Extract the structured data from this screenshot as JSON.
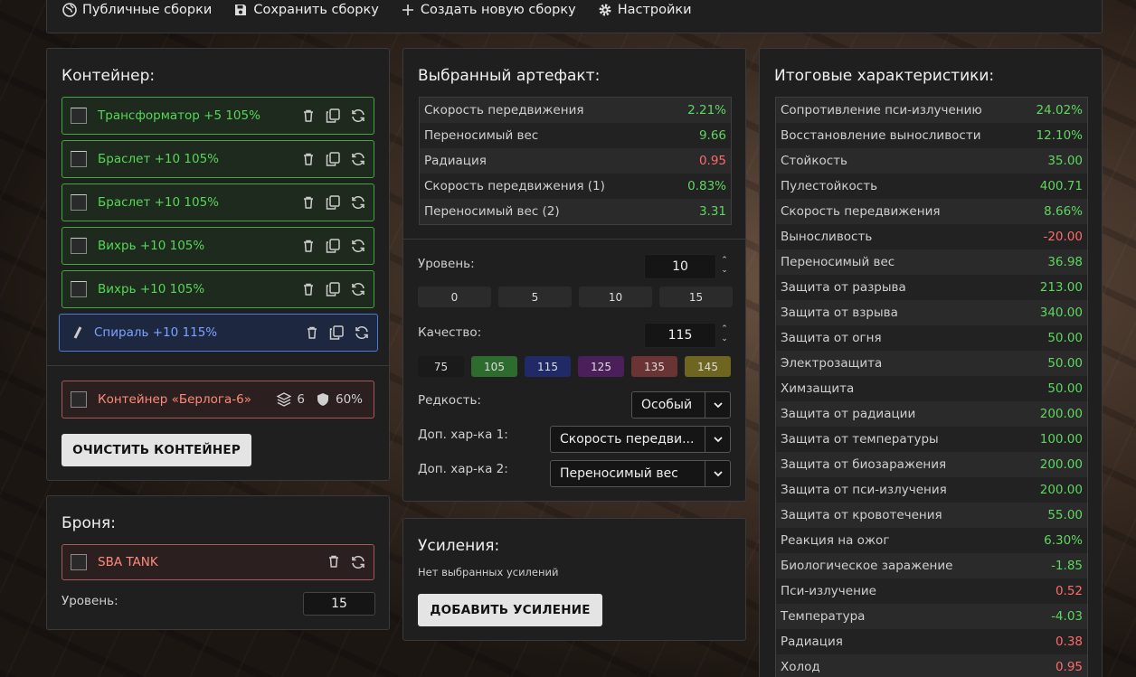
{
  "menu": {
    "public_builds": "Публичные сборки",
    "save_build": "Сохранить сборку",
    "new_build": "Создать новую сборку",
    "settings": "Настройки"
  },
  "container": {
    "title": "Контейнер:",
    "slots": [
      {
        "name": "Трансформатор +5 105%"
      },
      {
        "name": "Браслет +10 105%"
      },
      {
        "name": "Браслет +10 105%"
      },
      {
        "name": "Вихрь +10 105%"
      },
      {
        "name": "Вихрь +10 105%"
      },
      {
        "name": "Спираль +10 115%"
      }
    ],
    "item": {
      "name": "Контейнер «Берлога-6»",
      "slots_count": "6",
      "protection": "60%"
    },
    "clear_button": "ОЧИСТИТЬ КОНТЕЙНЕР"
  },
  "armor": {
    "title": "Броня:",
    "name": "SBA TANK",
    "level_label": "Уровень:",
    "level_value": "15"
  },
  "artifact": {
    "title": "Выбранный артефакт:",
    "stats": [
      {
        "label": "Скорость передвижения",
        "value": "2.21%",
        "kind": "pos"
      },
      {
        "label": "Переносимый вес",
        "value": "9.66",
        "kind": "pos"
      },
      {
        "label": "Радиация",
        "value": "0.95",
        "kind": "neg"
      },
      {
        "label": "Скорость передвижения (1)",
        "value": "0.83%",
        "kind": "pos"
      },
      {
        "label": "Переносимый вес (2)",
        "value": "3.31",
        "kind": "pos"
      }
    ],
    "level_label": "Уровень:",
    "level_value": "10",
    "level_presets": [
      "0",
      "5",
      "10",
      "15"
    ],
    "quality_label": "Качество:",
    "quality_value": "115",
    "quality_presets": [
      {
        "label": "75",
        "color": "#1a1a1a"
      },
      {
        "label": "105",
        "color": "#2e6b2e"
      },
      {
        "label": "115",
        "color": "#1f2a66"
      },
      {
        "label": "125",
        "color": "#4a1f5a"
      },
      {
        "label": "135",
        "color": "#6a3434"
      },
      {
        "label": "145",
        "color": "#6e6620"
      }
    ],
    "rarity_label": "Редкость:",
    "rarity_value": "Особый",
    "extra1_label": "Доп. хар-ка 1:",
    "extra1_value": "Скорость передви...",
    "extra2_label": "Доп. хар-ка 2:",
    "extra2_value": "Переносимый вес"
  },
  "boosts": {
    "title": "Усиления:",
    "empty_text": "Нет выбранных усилений",
    "add_button": "ДОБАВИТЬ УСИЛЕНИЕ"
  },
  "totals": {
    "title": "Итоговые характеристики:",
    "stats": [
      {
        "label": "Сопротивление пси-излучению",
        "value": "24.02%",
        "kind": "pos"
      },
      {
        "label": "Восстановление выносливости",
        "value": "12.10%",
        "kind": "pos"
      },
      {
        "label": "Стойкость",
        "value": "35.00",
        "kind": "pos"
      },
      {
        "label": "Пулестойкость",
        "value": "400.71",
        "kind": "pos"
      },
      {
        "label": "Скорость передвижения",
        "value": "8.66%",
        "kind": "pos"
      },
      {
        "label": "Выносливость",
        "value": "-20.00",
        "kind": "neg"
      },
      {
        "label": "Переносимый вес",
        "value": "36.98",
        "kind": "pos"
      },
      {
        "label": "Защита от разрыва",
        "value": "213.00",
        "kind": "pos"
      },
      {
        "label": "Защита от взрыва",
        "value": "340.00",
        "kind": "pos"
      },
      {
        "label": "Защита от огня",
        "value": "50.00",
        "kind": "pos"
      },
      {
        "label": "Электрозащита",
        "value": "50.00",
        "kind": "pos"
      },
      {
        "label": "Химзащита",
        "value": "50.00",
        "kind": "pos"
      },
      {
        "label": "Защита от радиации",
        "value": "200.00",
        "kind": "pos"
      },
      {
        "label": "Защита от температуры",
        "value": "100.00",
        "kind": "pos"
      },
      {
        "label": "Защита от биозаражения",
        "value": "200.00",
        "kind": "pos"
      },
      {
        "label": "Защита от пси-излучения",
        "value": "200.00",
        "kind": "pos"
      },
      {
        "label": "Защита от кровотечения",
        "value": "55.00",
        "kind": "pos"
      },
      {
        "label": "Реакция на ожог",
        "value": "6.30%",
        "kind": "pos"
      },
      {
        "label": "Биологическое заражение",
        "value": "-1.85",
        "kind": "pos"
      },
      {
        "label": "Пси-излучение",
        "value": "0.52",
        "kind": "neg"
      },
      {
        "label": "Температура",
        "value": "-4.03",
        "kind": "pos"
      },
      {
        "label": "Радиация",
        "value": "0.38",
        "kind": "neg"
      },
      {
        "label": "Холод",
        "value": "0.95",
        "kind": "neg"
      }
    ]
  }
}
